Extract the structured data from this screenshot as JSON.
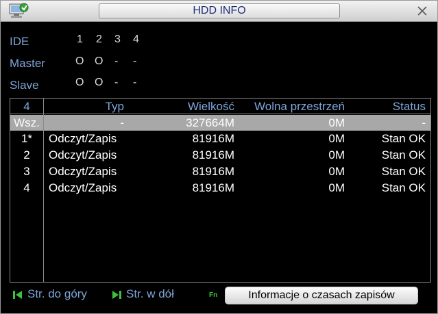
{
  "window": {
    "title": "HDD INFO"
  },
  "summary": {
    "ports_label": "IDE",
    "ports": [
      "1",
      "2",
      "3",
      "4"
    ],
    "master_label": "Master",
    "master": [
      "O",
      "O",
      "-",
      "-"
    ],
    "slave_label": "Slave",
    "slave": [
      "O",
      "O",
      "-",
      "-"
    ]
  },
  "table": {
    "headers": [
      "4",
      "Typ",
      "Wielkość",
      "Wolna przestrzeń",
      "Status"
    ],
    "rows": [
      [
        "Wsz.",
        "-",
        "327664M",
        "0M",
        "-"
      ],
      [
        "1*",
        "Odczyt/Zapis",
        "81916M",
        "0M",
        "Stan OK"
      ],
      [
        "2",
        "Odczyt/Zapis",
        "81916M",
        "0M",
        "Stan OK"
      ],
      [
        "3",
        "Odczyt/Zapis",
        "81916M",
        "0M",
        "Stan OK"
      ],
      [
        "4",
        "Odczyt/Zapis",
        "81916M",
        "0M",
        "Stan OK"
      ]
    ]
  },
  "footer": {
    "page_up": "Str. do góry",
    "page_down": "Str. w dół",
    "fn": "Fn",
    "record_times_button": "Informacje o czasach zapisów"
  },
  "colors": {
    "label_blue": "#7fa4d8",
    "selected_row": "#a8a8a8",
    "pager_green": "#3ec03e"
  }
}
